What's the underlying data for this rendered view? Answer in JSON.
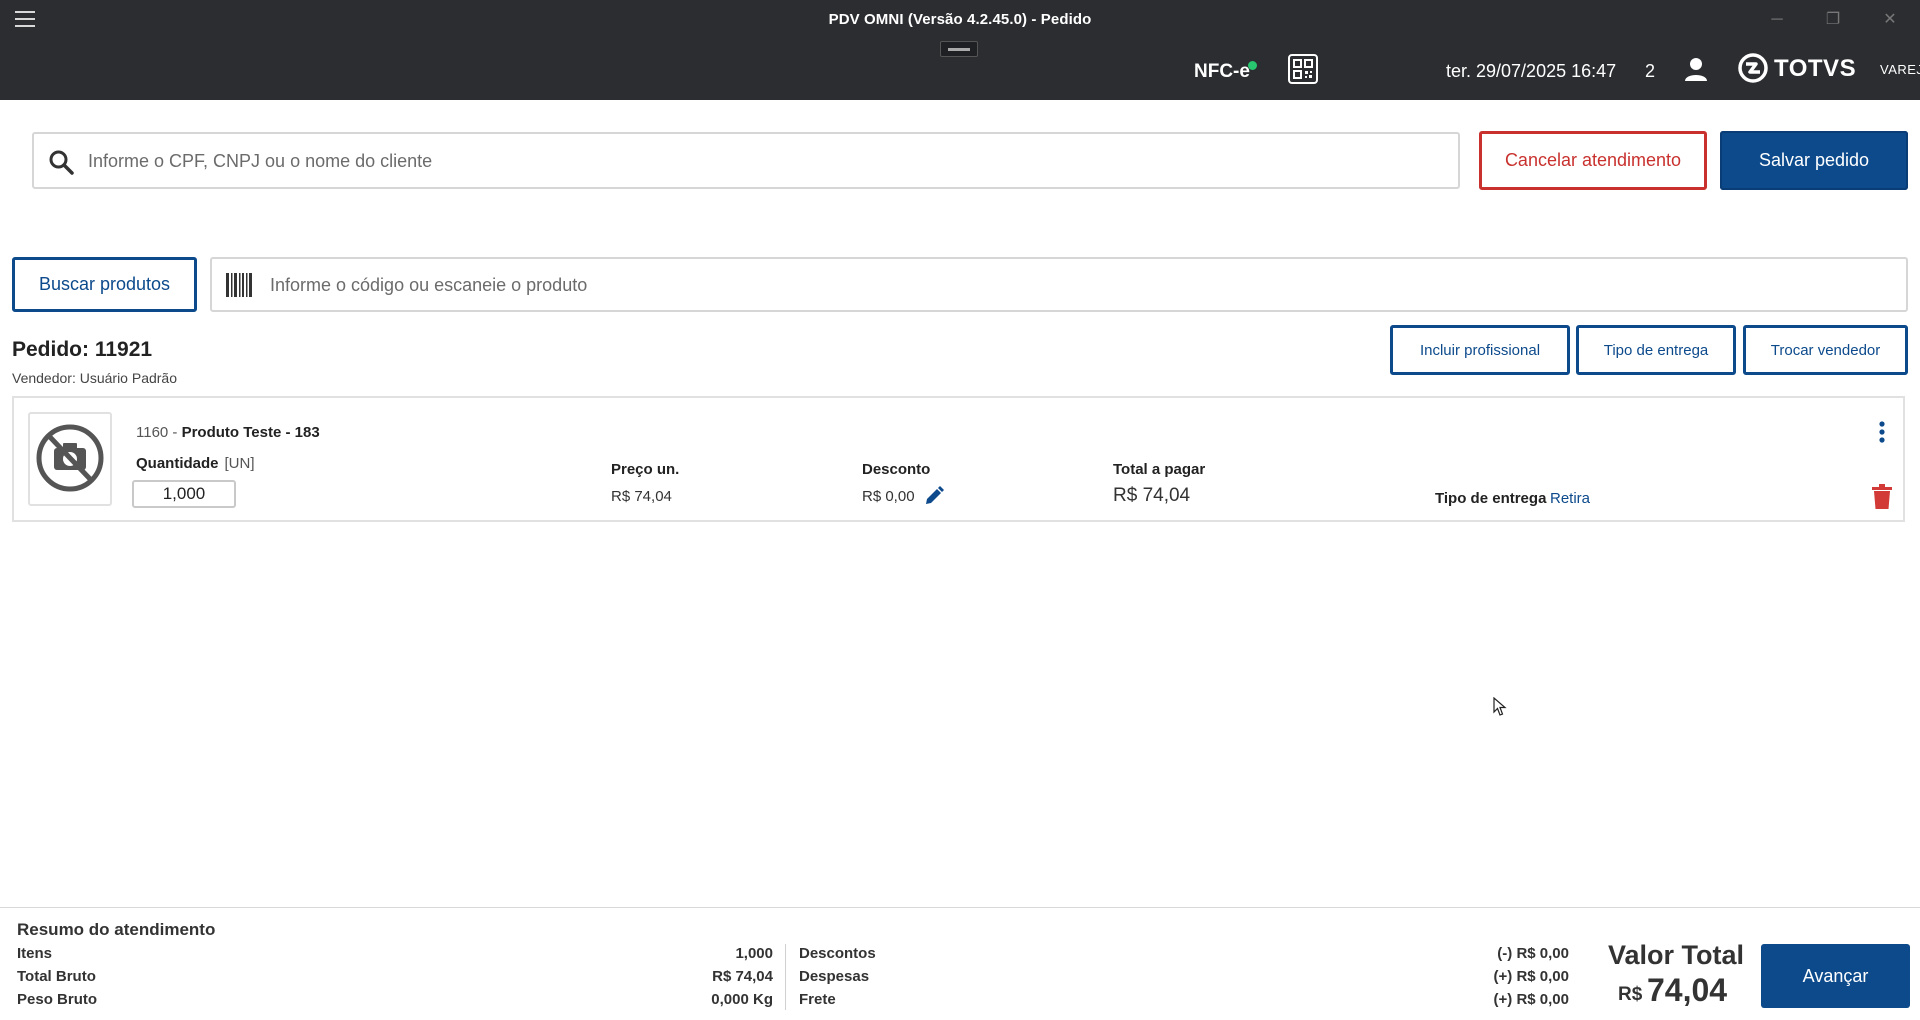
{
  "window": {
    "title": "PDV OMNI (Versão 4.2.45.0) - Pedido",
    "minimize": "─",
    "restore": "❐",
    "close": "✕"
  },
  "header": {
    "nfce": "NFC-e",
    "datetime": "ter. 29/07/2025 16:47",
    "count": "2",
    "brand": "TOTVS",
    "brand_sub": "VAREJO",
    "status_color": "#28c76f"
  },
  "client": {
    "placeholder": "Informe o CPF, CNPJ ou o nome do cliente",
    "cancel_label": "Cancelar atendimento",
    "save_label": "Salvar pedido"
  },
  "product_search": {
    "button_label": "Buscar produtos",
    "placeholder": "Informe o código ou escaneie o produto"
  },
  "order": {
    "title": "Pedido: 11921",
    "seller": "Vendedor: Usuário Padrão",
    "actions": {
      "professional": "Incluir profissional",
      "delivery_type": "Tipo de entrega",
      "change_seller": "Trocar vendedor"
    }
  },
  "item": {
    "code": "1160 - ",
    "name": "Produto Teste - 183",
    "quantity_label": "Quantidade",
    "unit": "[UN]",
    "quantity": "1,000",
    "unit_price_label": "Preço un.",
    "unit_price": "R$ 74,04",
    "discount_label": "Desconto",
    "discount": "R$ 0,00",
    "total_label": "Total a pagar",
    "total": "R$ 74,04",
    "delivery_label": "Tipo de entrega",
    "delivery_value": "Retira"
  },
  "summary": {
    "title": "Resumo do atendimento",
    "items_label": "Itens",
    "items_value": "1,000",
    "gross_label": "Total Bruto",
    "gross_value": "R$ 74,04",
    "weight_label": "Peso Bruto",
    "weight_value": "0,000 Kg",
    "discounts_label": "Descontos",
    "discounts_value": "(-) R$ 0,00",
    "expenses_label": "Despesas",
    "expenses_value": "(+) R$ 0,00",
    "freight_label": "Frete",
    "freight_value": "(+) R$ 0,00",
    "total_label": "Valor Total",
    "total_currency": "R$",
    "total_value": "74,04",
    "advance_label": "Avançar"
  },
  "colors": {
    "primary": "#0c4a8c",
    "danger": "#c8312e",
    "header_bg": "#2b2d31"
  }
}
